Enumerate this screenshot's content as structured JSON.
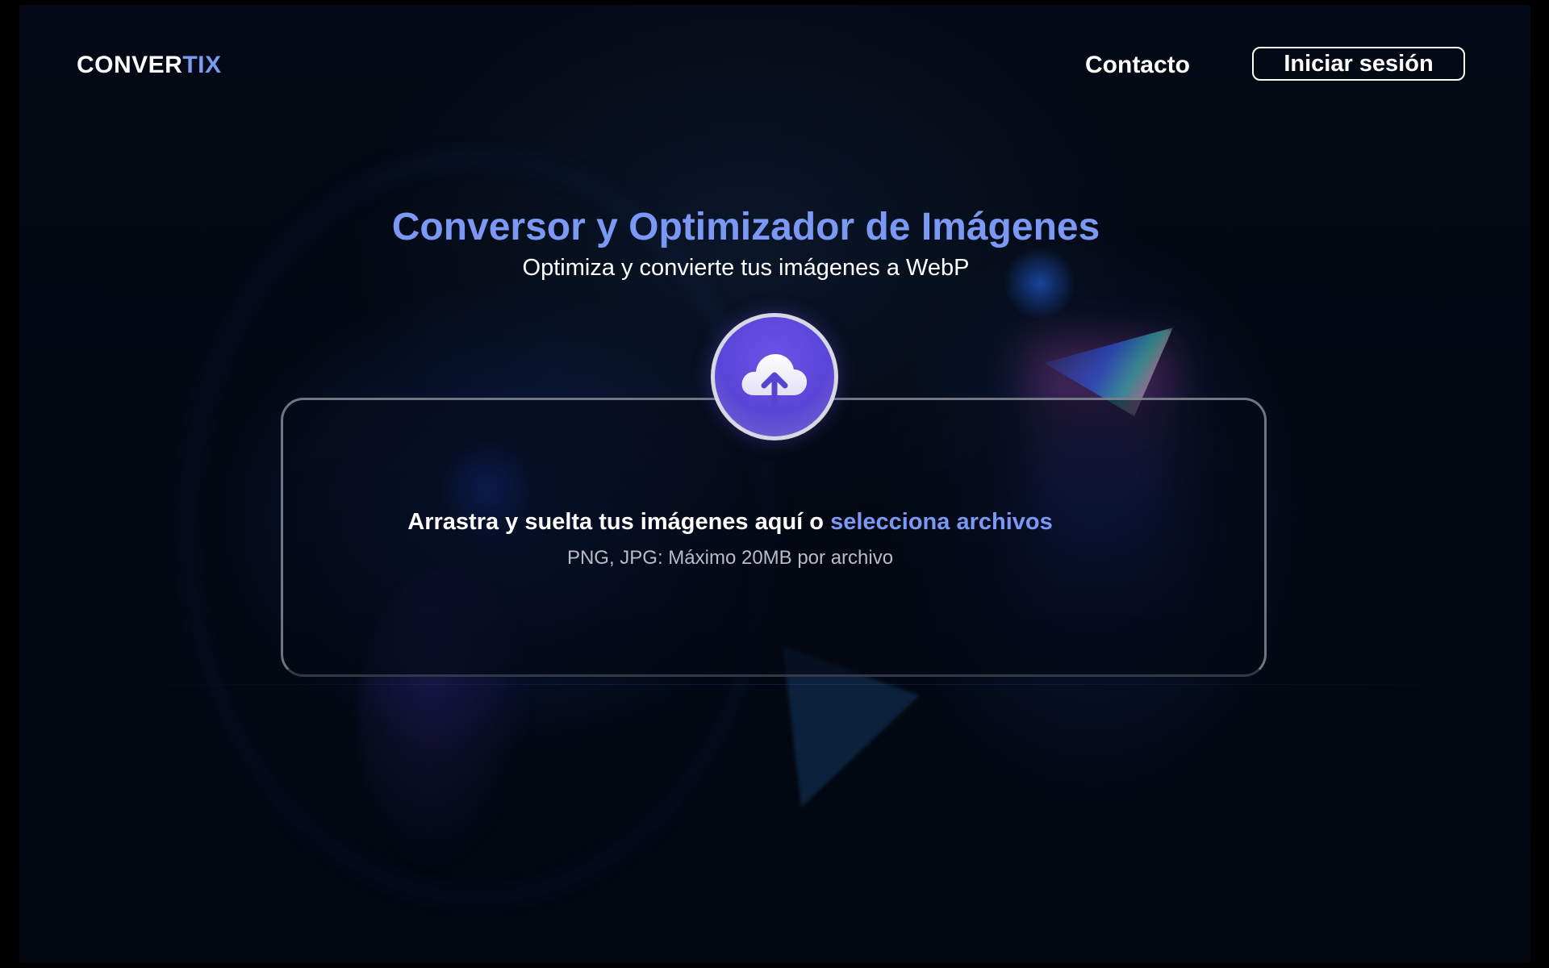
{
  "header": {
    "logo_prefix": "CONVER",
    "logo_suffix": "TIX",
    "nav_contact": "Contacto",
    "login_label": "Iniciar sesión"
  },
  "hero": {
    "title": "Conversor y Optimizador de Imágenes",
    "subtitle": "Optimiza y convierte tus imágenes a WebP"
  },
  "dropzone": {
    "icon": "cloud-upload-icon",
    "text_before_link": "Arrastra y suelta tus imágenes aquí o ",
    "link_label": "selecciona archivos",
    "hint": "PNG, JPG: Máximo 20MB por archivo"
  },
  "colors": {
    "background": "#030913",
    "accent": "#7a98f4",
    "upload_button": "#5b45d8",
    "text": "#ffffff",
    "muted_text": "#b9bcc6"
  }
}
